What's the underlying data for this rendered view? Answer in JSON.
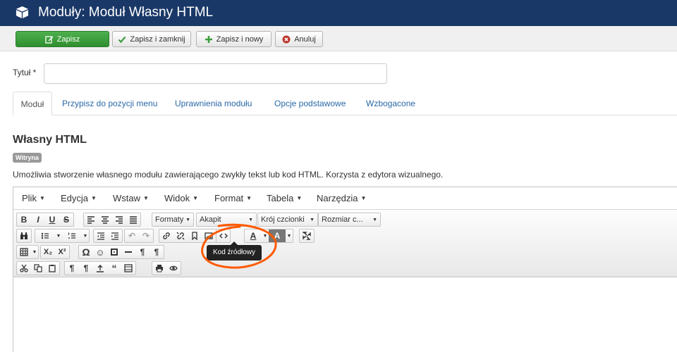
{
  "header": {
    "title": "Moduły: Moduł Własny HTML"
  },
  "toolbar": {
    "save": "Zapisz",
    "save_close": "Zapisz i zamknij",
    "save_new": "Zapisz i nowy",
    "cancel": "Anuluj"
  },
  "form": {
    "title_label": "Tytuł *",
    "title_value": ""
  },
  "tabs": [
    {
      "label": "Moduł"
    },
    {
      "label": "Przypisz do pozycji menu"
    },
    {
      "label": "Uprawnienia modułu"
    },
    {
      "label": "Opcje podstawowe"
    },
    {
      "label": "Wzbogacone"
    }
  ],
  "module": {
    "heading": "Własny HTML",
    "badge": "Witryna",
    "description": "Umożliwia stworzenie własnego modułu zawierającego zwykły tekst lub kod HTML. Korzysta z edytora wizualnego."
  },
  "editor": {
    "menu": [
      {
        "label": "Plik"
      },
      {
        "label": "Edycja"
      },
      {
        "label": "Wstaw"
      },
      {
        "label": "Widok"
      },
      {
        "label": "Format"
      },
      {
        "label": "Tabela"
      },
      {
        "label": "Narzędzia"
      }
    ],
    "dropdowns": {
      "formats": "Formaty",
      "paragraph": "Akapit",
      "font": "Krój czcionki",
      "size": "Rozmiar c..."
    },
    "tooltip": "Kod źródłowy"
  },
  "colors": {
    "header_bg": "#1a3867",
    "save_green": "#3c9f3c",
    "link": "#2a69a8",
    "annotation": "#ff5a00"
  }
}
